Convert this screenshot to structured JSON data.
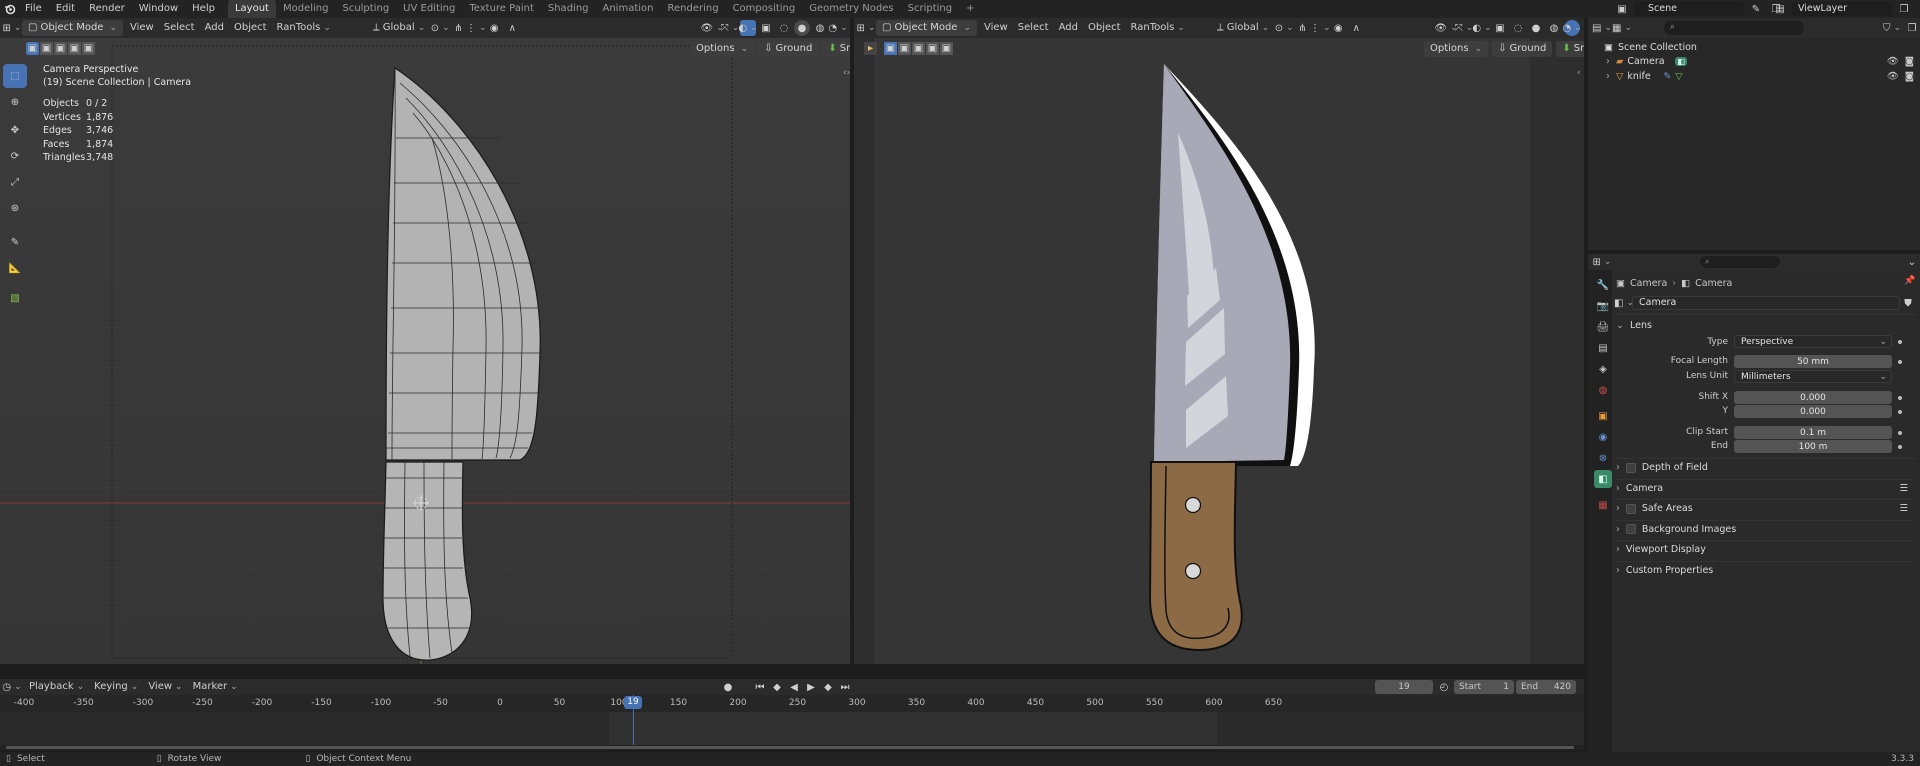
{
  "menu": {
    "items": [
      "File",
      "Edit",
      "Render",
      "Window",
      "Help"
    ],
    "workspaces": [
      "Layout",
      "Modeling",
      "Sculpting",
      "UV Editing",
      "Texture Paint",
      "Shading",
      "Animation",
      "Rendering",
      "Compositing",
      "Geometry Nodes",
      "Scripting"
    ],
    "active_workspace": "Layout",
    "add_tab": "+"
  },
  "scene": {
    "name": "Scene",
    "view_layer": "ViewLayer"
  },
  "viewport_left": {
    "mode": "Object Mode",
    "menus": [
      "View",
      "Select",
      "Add",
      "Object",
      "RanTools"
    ],
    "orientation": "Global",
    "options": "Options",
    "ground": "Ground",
    "snap": "Snap",
    "hud_title": "Camera Perspective",
    "hud_sub": "(19) Scene Collection | Camera",
    "stats": [
      {
        "k": "Objects",
        "v": "0 / 2"
      },
      {
        "k": "Vertices",
        "v": "1,876"
      },
      {
        "k": "Edges",
        "v": "3,746"
      },
      {
        "k": "Faces",
        "v": "1,874"
      },
      {
        "k": "Triangles",
        "v": "3,748"
      }
    ]
  },
  "viewport_right": {
    "mode": "Object Mode",
    "menus": [
      "View",
      "Select",
      "Add",
      "Object",
      "RanTools"
    ],
    "orientation": "Global",
    "options": "Options",
    "ground": "Ground",
    "snap": "Snap"
  },
  "outliner": {
    "root": "Scene Collection",
    "items": [
      {
        "name": "Camera"
      },
      {
        "name": "knife"
      }
    ]
  },
  "properties": {
    "breadcrumb": [
      "Camera",
      "Camera"
    ],
    "datablock": "Camera",
    "lens_section": "Lens",
    "fields": [
      {
        "label": "Type",
        "value": "Perspective",
        "kind": "dropdown"
      },
      {
        "label": "Focal Length",
        "value": "50 mm",
        "kind": "number"
      },
      {
        "label": "Lens Unit",
        "value": "Millimeters",
        "kind": "dropdown"
      },
      {
        "label": "Shift X",
        "value": "0.000",
        "kind": "number"
      },
      {
        "label": "Y",
        "value": "0.000",
        "kind": "number"
      },
      {
        "label": "Clip Start",
        "value": "0.1 m",
        "kind": "number"
      },
      {
        "label": "End",
        "value": "100 m",
        "kind": "number"
      }
    ],
    "subsections": [
      {
        "label": "Depth of Field",
        "check": true,
        "list": false
      },
      {
        "label": "Camera",
        "check": false,
        "list": true
      },
      {
        "label": "Safe Areas",
        "check": true,
        "list": true
      },
      {
        "label": "Background Images",
        "check": true,
        "list": false
      },
      {
        "label": "Viewport Display",
        "check": false,
        "list": false
      },
      {
        "label": "Custom Properties",
        "check": false,
        "list": false
      }
    ]
  },
  "timeline": {
    "menus": [
      "Playback",
      "Keying",
      "View",
      "Marker"
    ],
    "current_frame": "19",
    "start_label": "Start",
    "start": "1",
    "end_label": "End",
    "end": "420",
    "ticks": [
      "-400",
      "-350",
      "-300",
      "-250",
      "-200",
      "-150",
      "-100",
      "-50",
      "0",
      "50",
      "100",
      "150",
      "200",
      "250",
      "300",
      "350",
      "400",
      "450",
      "500",
      "550",
      "600",
      "650"
    ]
  },
  "status": {
    "select": "Select",
    "rotate": "Rotate View",
    "context": "Object Context Menu",
    "version": "3.3.3"
  },
  "colors": {
    "accent": "#4772b3",
    "blade": "#a9a8b6",
    "handle": "#8b6a45",
    "camera_icon": "#d28d44",
    "mesh_icon": "#e99a3b"
  }
}
